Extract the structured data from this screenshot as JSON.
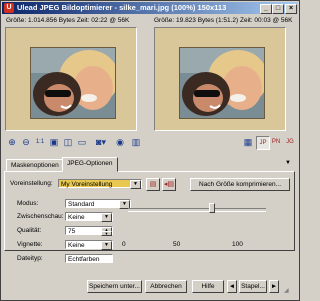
{
  "window": {
    "title": "Ulead JPEG Bildoptimierer - silke_mari.jpg (100%) 150x113",
    "minimize": "_",
    "maximize": "□",
    "close": "×"
  },
  "preview": {
    "left_info": "Größe: 1.014.856 Bytes Zeit: 02:22 @ 56K",
    "right_info": "Größe: 19.823 Bytes (1:51.2) Zeit: 00:03 @ 56K"
  },
  "toolbar": {
    "zoom_in": "⊕",
    "zoom_out": "⊖",
    "ratio": "1:1"
  },
  "tabs": [
    {
      "label": "Maskenoptionen"
    },
    {
      "label": "JPEG-Optionen"
    }
  ],
  "options": {
    "preset_label": "Voreinstellung:",
    "preset_value": "My Voreinstellung",
    "compress_button": "Nach Größe komprimieren...",
    "mode_label": "Modus:",
    "mode_value": "Standard",
    "subsampling_label": "Zwischenschau:",
    "subsampling_value": "Keine",
    "quality_label": "Qualität:",
    "quality_value": "75",
    "vignette_label": "Vignette:",
    "vignette_value": "Keine",
    "filetype_label": "Dateityp:",
    "filetype_value": "Echtfarben",
    "slider_min": "0",
    "slider_mid": "50",
    "slider_max": "100",
    "slider_fraction": 0.6
  },
  "footer": {
    "save": "Speichern unter...",
    "cancel": "Abbrechen",
    "help": "Hilfe",
    "batch": "Stapel...",
    "nav_prev": "◄",
    "nav_next": "►"
  }
}
